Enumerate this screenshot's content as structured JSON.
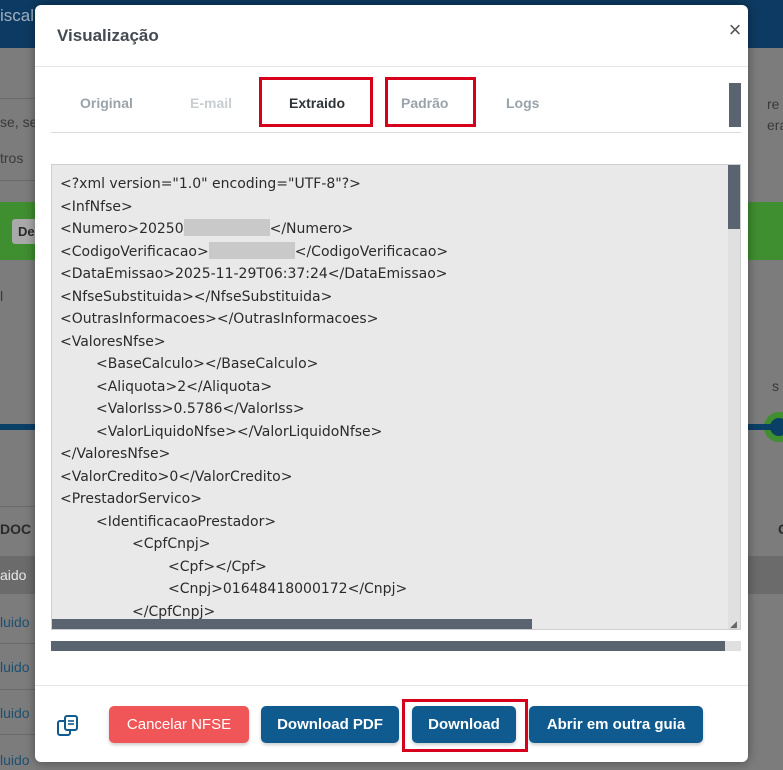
{
  "background": {
    "topbar_text": "iscal",
    "snippet_left_1": "se, se",
    "snippet_left_2": "tros",
    "button_left": "De",
    "header_left": "DOC",
    "row_dark_left": "aido",
    "row_links": [
      "luido",
      "luido",
      "luido",
      "luido"
    ],
    "snippet_right_1": "re",
    "snippet_right_2": "era",
    "snippet_right_3": "s",
    "header_right": "C"
  },
  "modal": {
    "title": "Visualização",
    "close_label": "×",
    "tabs": [
      {
        "label": "Original",
        "state": "normal"
      },
      {
        "label": "E-mail",
        "state": "disabled"
      },
      {
        "label": "Extraido",
        "state": "active"
      },
      {
        "label": "Padrão",
        "state": "normal"
      },
      {
        "label": "Logs",
        "state": "normal"
      }
    ],
    "code_lines": [
      {
        "indent": 0,
        "text": "<?xml version=\"1.0\" encoding=\"UTF-8\"?>"
      },
      {
        "indent": 0,
        "text": "<InfNfse>"
      },
      {
        "indent": 0,
        "before": "<Numero>20250",
        "redacted": true,
        "after": "</Numero>"
      },
      {
        "indent": 0,
        "before": "<CodigoVerificacao>",
        "redacted": true,
        "after": "</CodigoVerificacao>"
      },
      {
        "indent": 0,
        "text": "<DataEmissao>2025-11-29T06:37:24</DataEmissao>"
      },
      {
        "indent": 0,
        "text": "<NfseSubstituida></NfseSubstituida>"
      },
      {
        "indent": 0,
        "text": "<OutrasInformacoes></OutrasInformacoes>"
      },
      {
        "indent": 0,
        "text": "<ValoresNfse>"
      },
      {
        "indent": 1,
        "text": "<BaseCalculo></BaseCalculo>"
      },
      {
        "indent": 1,
        "text": "<Aliquota>2</Aliquota>"
      },
      {
        "indent": 1,
        "text": "<ValorIss>0.5786</ValorIss>"
      },
      {
        "indent": 1,
        "text": "<ValorLiquidoNfse></ValorLiquidoNfse>"
      },
      {
        "indent": 0,
        "text": "</ValoresNfse>"
      },
      {
        "indent": 0,
        "text": "<ValorCredito>0</ValorCredito>"
      },
      {
        "indent": 0,
        "text": "<PrestadorServico>"
      },
      {
        "indent": 1,
        "text": "<IdentificacaoPrestador>"
      },
      {
        "indent": 2,
        "text": "<CpfCnpj>"
      },
      {
        "indent": 3,
        "text": "<Cpf></Cpf>"
      },
      {
        "indent": 3,
        "text": "<Cnpj>01648418000172</Cnpj>"
      },
      {
        "indent": 2,
        "text": "</CpfCnpj>"
      }
    ],
    "footer": {
      "copy_icon": "copy-icon",
      "cancel_label": "Cancelar NFSE",
      "download_pdf_label": "Download PDF",
      "download_label": "Download",
      "open_tab_label": "Abrir em outra guia"
    }
  },
  "colors": {
    "highlight": "#d6001c",
    "primary_button": "#0f5a8e",
    "danger_button": "#f05557"
  }
}
